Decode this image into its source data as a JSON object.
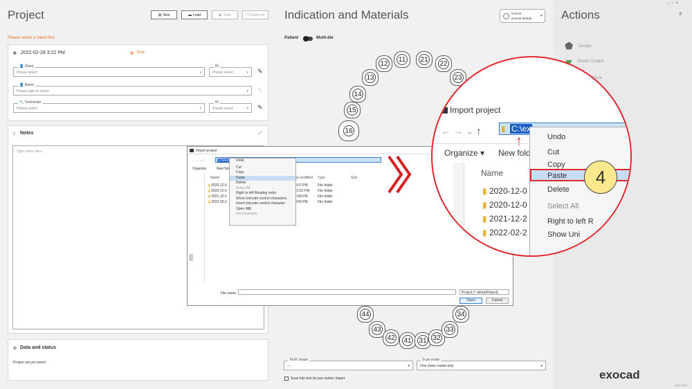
{
  "project": {
    "title": "Project",
    "buttons": {
      "new": "New",
      "load": "Load",
      "save": "Save",
      "duplicate": "Duplicate"
    },
    "warning": "Please select a client first.",
    "date": "2022-02-28 3:22 PM",
    "due": "Due",
    "client": {
      "label": "Client",
      "placeholder": "Please select",
      "id_label": "ID",
      "id_placeholder": "Please select"
    },
    "name": {
      "label": "Name",
      "placeholder": "Please type or select"
    },
    "technician": {
      "label": "Technician",
      "placeholder": "Please select",
      "id_label": "ID",
      "id_placeholder": "Please select"
    },
    "notes": {
      "title": "Notes",
      "placeholder": "Type notes here..."
    },
    "data_status": {
      "title": "Data and status",
      "text": "Project not yet saved"
    }
  },
  "indication": {
    "title": "Indication and Materials",
    "default_label": "Default",
    "default_value": "exocad default",
    "patient": "Patient",
    "multidie": "Multi-die",
    "teeth_upper": [
      "11",
      "12",
      "13",
      "14",
      "15",
      "16",
      "21",
      "22",
      "23"
    ],
    "teeth_lower": [
      "33",
      "34",
      "31",
      "32",
      "41",
      "42",
      "43",
      "44"
    ],
    "tooth_shade_label": "Tooth shade",
    "tooth_shade_value": "---",
    "scan_mode_label": "Scan mode",
    "scan_mode_value": "One stone model only",
    "scan_bite_fork": "Scan bite fork for jaw motion import"
  },
  "actions": {
    "title": "Actions",
    "help": "?",
    "items": [
      "Design",
      "Model Creator",
      "Manufacture"
    ],
    "logo": "exocad",
    "version": "v3.0-7734"
  },
  "dialog": {
    "title": "Import project",
    "path": "C:\\exocad\\...\\Desktop\\...\\S0001.dm",
    "organize": "Organize",
    "new_folder": "New folder",
    "col_name": "Name",
    "col_modified": "Date modified",
    "col_type": "Type",
    "col_size": "Size",
    "files": [
      {
        "name": "2020-12-0",
        "date": "4:07 PM",
        "type": "File folder"
      },
      {
        "name": "2020-12-0",
        "date": "10:51 PM",
        "type": "File folder"
      },
      {
        "name": "2021-12-2",
        "date": "4:08 PM",
        "type": "File folder"
      },
      {
        "name": "2022-02-2",
        "date": "3:56 PM",
        "type": "File folder"
      }
    ],
    "file_name_label": "File name:",
    "filter": "Project (*.dentalProject)",
    "open": "Open",
    "cancel": "Cancel"
  },
  "context_menu": [
    "Undo",
    "Cut",
    "Copy",
    "Paste",
    "Delete",
    "Select All",
    "Right to left Reading order",
    "Show Unicode control characters",
    "Insert Unicode control character",
    "Open IME",
    "Reconversion"
  ],
  "zoom": {
    "title": "Import project",
    "path": "C:\\ex",
    "organize": "Organize",
    "new_folder": "New fold",
    "col_name": "Name",
    "files": [
      "2020-12-0",
      "2020-12-0",
      "2021-12-2",
      "2022-02-2"
    ],
    "menu": [
      "Undo",
      "Cut",
      "Copy",
      "Paste",
      "Delete",
      "Select All",
      "Right to left R",
      "Show Uni"
    ],
    "step": "4"
  }
}
